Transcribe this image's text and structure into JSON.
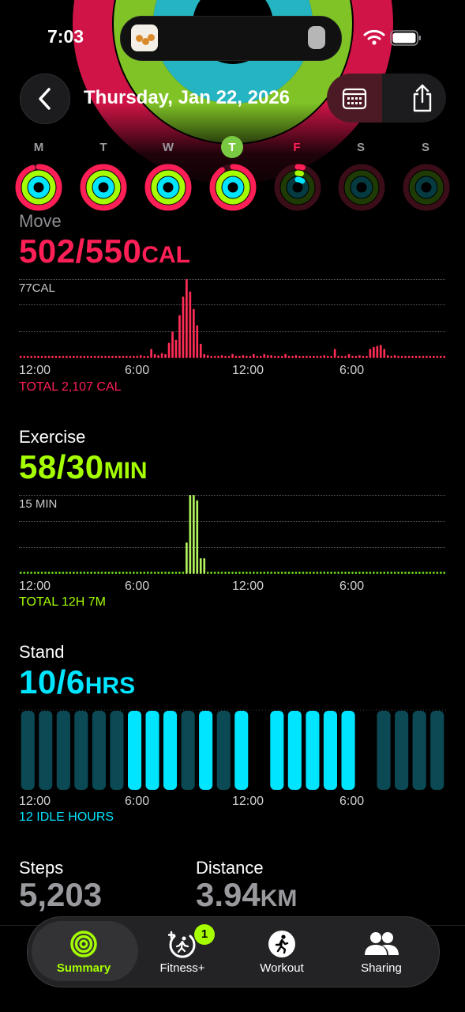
{
  "status_bar": {
    "time": "7:03"
  },
  "header": {
    "date_title": "Thursday, Jan 22, 2026"
  },
  "week": {
    "days": [
      {
        "label": "M",
        "move": 0.95,
        "exercise": 1.0,
        "stand": 1.0,
        "state": "past"
      },
      {
        "label": "T",
        "move": 1.0,
        "exercise": 1.0,
        "stand": 1.0,
        "state": "past"
      },
      {
        "label": "W",
        "move": 1.0,
        "exercise": 1.0,
        "stand": 1.0,
        "state": "past"
      },
      {
        "label": "T",
        "move": 0.91,
        "exercise": 1.0,
        "stand": 1.0,
        "state": "today"
      },
      {
        "label": "F",
        "move": 0.04,
        "exercise": 0.04,
        "stand": 0.1,
        "state": "future-partial"
      },
      {
        "label": "S",
        "move": 0,
        "exercise": 0,
        "stand": 0,
        "state": "future"
      },
      {
        "label": "S",
        "move": 0,
        "exercise": 0,
        "stand": 0,
        "state": "future"
      }
    ]
  },
  "colors": {
    "move": "#ff1f57",
    "exercise": "#a6ff00",
    "stand": "#00e5ff",
    "move_chart": "#ff2d55",
    "exercise_chart": "#b0f05a"
  },
  "move": {
    "title": "Move",
    "value": "502/550",
    "unit": "CAL",
    "scale_label": "77CAL",
    "axis": [
      "12:00",
      "6:00",
      "12:00",
      "6:00"
    ],
    "total": "TOTAL 2,107 CAL",
    "bars": [
      2,
      2,
      2,
      2,
      2,
      2,
      2,
      2,
      2,
      2,
      2,
      2,
      2,
      2,
      2,
      2,
      2,
      2,
      2,
      2,
      2,
      2,
      2,
      2,
      2,
      2,
      2,
      2,
      2,
      2,
      2,
      2,
      2,
      2,
      3,
      2,
      2,
      9,
      4,
      3,
      5,
      4,
      15,
      26,
      18,
      42,
      60,
      77,
      65,
      48,
      32,
      14,
      4,
      3,
      2,
      2,
      2,
      3,
      2,
      2,
      4,
      2,
      2,
      3,
      2,
      2,
      4,
      2,
      2,
      4,
      3,
      3,
      2,
      2,
      2,
      4,
      2,
      2,
      3,
      2,
      2,
      2,
      2,
      2,
      2,
      2,
      3,
      2,
      2,
      9,
      2,
      2,
      2,
      4,
      2,
      2,
      3,
      2,
      2,
      9,
      11,
      12,
      13,
      9,
      3,
      2,
      3,
      2,
      2,
      2,
      2,
      2,
      2,
      2,
      2,
      2,
      2,
      2,
      2,
      2,
      2
    ]
  },
  "exercise": {
    "title": "Exercise",
    "value": "58/30",
    "unit": "MIN",
    "scale_label": "15 MIN",
    "axis": [
      "12:00",
      "6:00",
      "12:00",
      "6:00"
    ],
    "total": "TOTAL 12H 7M",
    "bars": [
      0,
      0,
      0,
      0,
      0,
      0,
      0,
      0,
      0,
      0,
      0,
      0,
      0,
      0,
      0,
      0,
      0,
      0,
      0,
      0,
      0,
      0,
      0,
      0,
      0,
      0,
      0,
      0,
      0,
      0,
      0,
      0,
      0,
      0,
      0,
      0,
      0,
      0,
      0,
      0,
      0,
      0,
      0,
      0,
      0,
      0,
      0,
      6,
      15,
      15,
      14,
      3,
      3,
      0,
      0,
      0,
      0,
      0,
      0,
      0,
      0,
      0,
      0,
      0,
      0,
      0,
      0,
      0,
      0,
      0,
      0,
      0,
      0,
      0,
      0,
      0,
      0,
      0,
      0,
      0,
      0,
      0,
      0,
      0,
      0,
      0,
      0,
      0,
      0,
      0,
      0,
      0,
      0,
      0,
      0,
      0,
      0,
      0,
      0,
      0,
      0,
      0,
      0,
      0,
      0,
      0,
      0,
      0,
      0,
      0,
      0,
      0,
      0,
      0,
      0,
      0,
      0,
      0,
      0,
      0,
      0
    ]
  },
  "stand": {
    "title": "Stand",
    "value": "10/6",
    "unit": "HRS",
    "axis": [
      "12:00",
      "6:00",
      "12:00",
      "6:00"
    ],
    "total": "12 IDLE HOURS",
    "hours": [
      0,
      0,
      0,
      0,
      0,
      0,
      1,
      1,
      1,
      0,
      1,
      0,
      1,
      -1,
      1,
      1,
      1,
      1,
      1,
      -1,
      0,
      0,
      0,
      0
    ]
  },
  "stats": {
    "steps": {
      "title": "Steps",
      "value": "5,203"
    },
    "distance": {
      "title": "Distance",
      "value": "3.94",
      "unit": "KM"
    }
  },
  "tabs": [
    {
      "label": "Summary",
      "active": true
    },
    {
      "label": "Fitness+",
      "active": false,
      "badge": "1"
    },
    {
      "label": "Workout",
      "active": false
    },
    {
      "label": "Sharing",
      "active": false
    }
  ]
}
